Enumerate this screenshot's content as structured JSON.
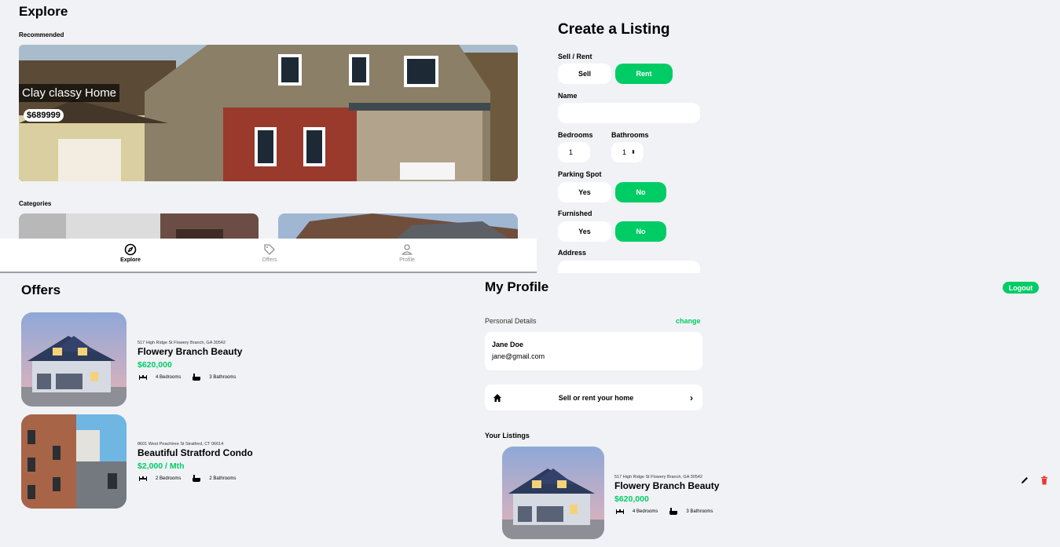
{
  "explore": {
    "title": "Explore",
    "recommended_label": "Recommended",
    "featured": {
      "name": "Clay classy Home",
      "price": "$689999"
    },
    "categories_label": "Categories",
    "tabs": [
      {
        "label": "Explore",
        "icon": "compass-icon"
      },
      {
        "label": "Offers",
        "icon": "tag-icon"
      },
      {
        "label": "Profile",
        "icon": "person-icon"
      }
    ]
  },
  "create": {
    "title": "Create a Listing",
    "sell_rent_label": "Sell / Rent",
    "sell": "Sell",
    "rent": "Rent",
    "name_label": "Name",
    "name_value": "",
    "bedrooms_label": "Bedrooms",
    "bedrooms_value": "1",
    "bathrooms_label": "Bathrooms",
    "bathrooms_value": "1",
    "parking_label": "Parking Spot",
    "furnished_label": "Furnished",
    "yes": "Yes",
    "no": "No",
    "address_label": "Address"
  },
  "offers": {
    "title": "Offers",
    "items": [
      {
        "address": "517 High Ridge St Flowery Branch, GA 30542",
        "name": "Flowery Branch Beauty",
        "price": "$620,000",
        "bedrooms": "4 Bedrooms",
        "bathrooms": "3 Bathrooms"
      },
      {
        "address": "8601 West Peachtree St Stratford, CT 06614",
        "name": "Beautiful Stratford Condo",
        "price": "$2,000 / Mth",
        "bedrooms": "2 Bedrooms",
        "bathrooms": "2 Bathrooms"
      }
    ]
  },
  "profile": {
    "title": "My Profile",
    "logout": "Logout",
    "personal_details_label": "Personal Details",
    "change": "change",
    "user_name": "Jane Doe",
    "user_email": "jane@gmail.com",
    "sell_rent_link": "Sell or rent your home",
    "your_listings_label": "Your Listings",
    "listing": {
      "address": "517 High Ridge St Flowery Branch, GA 30542",
      "name": "Flowery Branch Beauty",
      "price": "$620,000",
      "bedrooms": "4 Bedrooms",
      "bathrooms": "3 Bathrooms"
    }
  },
  "colors": {
    "accent": "#00cc66",
    "background": "#f1f2f5",
    "delete": "#e53935"
  }
}
